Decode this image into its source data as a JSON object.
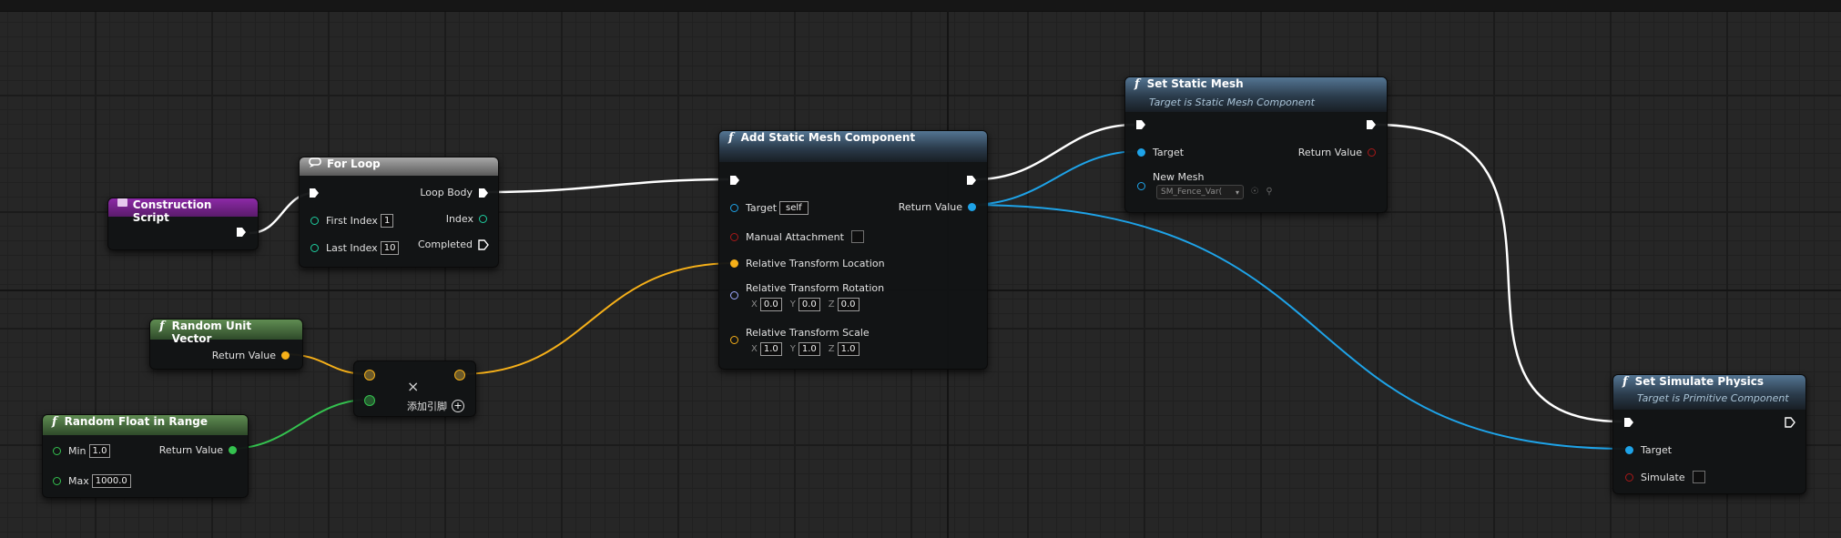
{
  "nodes": {
    "construction_script": {
      "title": "Construction Script"
    },
    "for_loop": {
      "title": "For Loop",
      "first_index_label": "First Index",
      "first_index_value": "1",
      "last_index_label": "Last Index",
      "last_index_value": "10",
      "loop_body_label": "Loop Body",
      "index_label": "Index",
      "completed_label": "Completed"
    },
    "add_static_mesh_component": {
      "title": "Add Static Mesh Component",
      "target_label": "Target",
      "target_value": "self",
      "manual_attachment_label": "Manual Attachment",
      "relative_location_label": "Relative Transform Location",
      "relative_rotation_label": "Relative Transform Rotation",
      "rotation": {
        "x": "0.0",
        "y": "0.0",
        "z": "0.0"
      },
      "relative_scale_label": "Relative Transform Scale",
      "scale": {
        "x": "1.0",
        "y": "1.0",
        "z": "1.0"
      },
      "return_value_label": "Return Value"
    },
    "set_static_mesh": {
      "title": "Set Static Mesh",
      "subtitle": "Target is Static Mesh Component",
      "target_label": "Target",
      "new_mesh_label": "New Mesh",
      "new_mesh_value": "SM_Fence_Var(",
      "return_value_label": "Return Value"
    },
    "set_simulate_physics": {
      "title": "Set Simulate Physics",
      "subtitle": "Target is Primitive Component",
      "target_label": "Target",
      "simulate_label": "Simulate"
    },
    "random_unit_vector": {
      "title": "Random Unit Vector",
      "return_value_label": "Return Value"
    },
    "random_float_in_range": {
      "title": "Random Float in Range",
      "min_label": "Min",
      "min_value": "1.0",
      "max_label": "Max",
      "max_value": "1000.0",
      "return_value_label": "Return Value"
    },
    "multiply": {
      "symbol": "×",
      "add_pin_label": "添加引脚"
    }
  },
  "axis_labels": {
    "x": "X",
    "y": "Y",
    "z": "Z"
  },
  "icons": {
    "function": "f",
    "event": "event-icon",
    "loop": "loop-icon",
    "add_pin": "plus-circle-icon",
    "browse": "browse-icon",
    "search": "search-icon",
    "dropdown": "chevron-down-icon"
  },
  "colors": {
    "exec_wire": "#ffffff",
    "object_pin": "#1ea3e8",
    "vector_pin": "#f6b019",
    "float_pin": "#34c24f",
    "int_pin": "#1ecfa0",
    "bool_pin": "#a81818",
    "rotator_pin": "#9fa8ff",
    "function_header": "#547593",
    "event_header": "#8c2aa6",
    "pure_header": "#5f8c52"
  }
}
